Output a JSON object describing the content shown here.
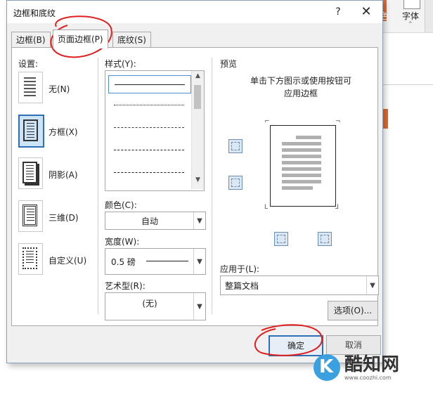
{
  "dialog": {
    "title": "边框和底纹",
    "help": "?",
    "close": "✕"
  },
  "tabs": [
    "边框(B)",
    "页面边框(P)",
    "底纹(S)"
  ],
  "setting": {
    "label": "设置:",
    "items": [
      "无(N)",
      "方框(X)",
      "阴影(A)",
      "三维(D)",
      "自定义(U)"
    ]
  },
  "style": {
    "label": "样式(Y):"
  },
  "color": {
    "label": "颜色(C):",
    "value": "自动"
  },
  "width": {
    "label": "宽度(W):",
    "value": "0.5 磅"
  },
  "art": {
    "label": "艺术型(R):",
    "value": "(无)"
  },
  "preview": {
    "label": "预览",
    "hint_line1": "单击下方图示或使用按钮可",
    "hint_line2": "应用边框"
  },
  "apply": {
    "label": "应用于(L):",
    "value": "整篇文档"
  },
  "buttons": {
    "options": "选项(O)...",
    "ok": "确定",
    "cancel": "取消"
  },
  "background": {
    "se": "色",
    "font": "字体"
  },
  "watermark": {
    "name": "酷知网",
    "url": "www.coozhi.com"
  },
  "colors": {
    "accent": "#2f6fb6",
    "annotation": "#e02020"
  }
}
